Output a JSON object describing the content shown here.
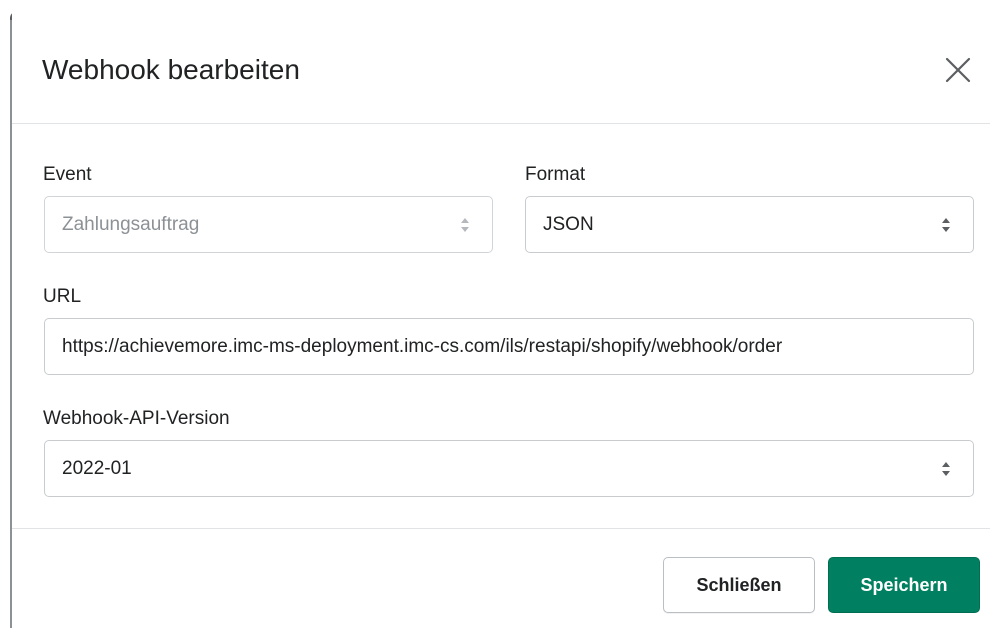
{
  "modal": {
    "title": "Webhook bearbeiten"
  },
  "form": {
    "event": {
      "label": "Event",
      "value": "Zahlungsauftrag",
      "disabled": true
    },
    "format": {
      "label": "Format",
      "value": "JSON"
    },
    "url": {
      "label": "URL",
      "value": "https://achievemore.imc-ms-deployment.imc-cs.com/ils/restapi/shopify/webhook/order"
    },
    "api_version": {
      "label": "Webhook-API-Version",
      "value": "2022-01"
    }
  },
  "footer": {
    "close_label": "Schließen",
    "save_label": "Speichern"
  },
  "colors": {
    "primary": "#008060",
    "border": "#c9cccf",
    "text": "#202223"
  }
}
